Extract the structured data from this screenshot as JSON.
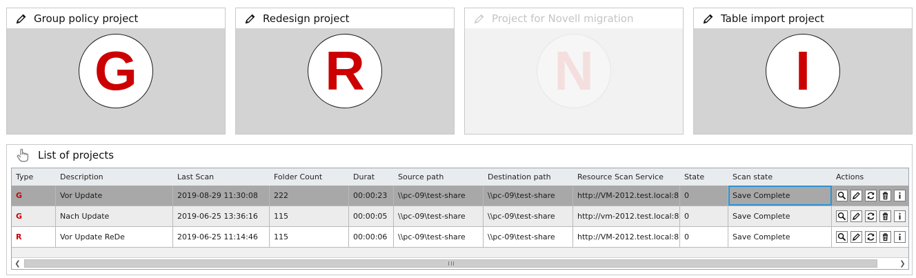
{
  "projects": [
    {
      "title": "Group policy project",
      "letter": "G",
      "enabled": true
    },
    {
      "title": "Redesign project",
      "letter": "R",
      "enabled": true
    },
    {
      "title": "Project for Novell migration",
      "letter": "N",
      "enabled": false
    },
    {
      "title": "Table import project",
      "letter": "I",
      "enabled": true
    }
  ],
  "list": {
    "title": "List of projects",
    "columns": [
      "Type",
      "Description",
      "Last Scan",
      "Folder Count",
      "Durat",
      "Source path",
      "Destination path",
      "Resource Scan Service",
      "State",
      "Scan state",
      "Actions"
    ],
    "rows": [
      {
        "type": "G",
        "description": "Vor Update",
        "last_scan": "2019-08-29 11:30:08",
        "folder_count": "222",
        "duration": "00:00:23",
        "source": "\\\\pc-09\\test-share",
        "destination": "\\\\pc-09\\test-share",
        "service": "http://VM-2012.test.local:8",
        "state": "0",
        "scan_state": "Save Complete"
      },
      {
        "type": "G",
        "description": "Nach Update",
        "last_scan": "2019-06-25 13:36:16",
        "folder_count": "115",
        "duration": "00:00:05",
        "source": "\\\\pc-09\\test-share",
        "destination": "\\\\pc-09\\test-share",
        "service": "http://vm-2012.test.local:8",
        "state": "0",
        "scan_state": "Save Complete"
      },
      {
        "type": "R",
        "description": "Vor Update ReDe",
        "last_scan": "2019-06-25 11:14:46",
        "folder_count": "115",
        "duration": "00:00:06",
        "source": "\\\\pc-09\\test-share",
        "destination": "\\\\pc-09\\test-share",
        "service": "http://VM-2012.test.local:8",
        "state": "0",
        "scan_state": "Save Complete"
      }
    ],
    "selected_row": 0
  },
  "icons": {
    "card": "pencil-icon",
    "list": "hand-pointer-icon",
    "actions": [
      "magnifier-icon",
      "pencil-icon",
      "refresh-icon",
      "trash-icon",
      "info-icon"
    ]
  },
  "colors": {
    "accent_red": "#cc0000",
    "focus_blue": "#2a93d5",
    "selected_row": "#a8a8a8"
  }
}
